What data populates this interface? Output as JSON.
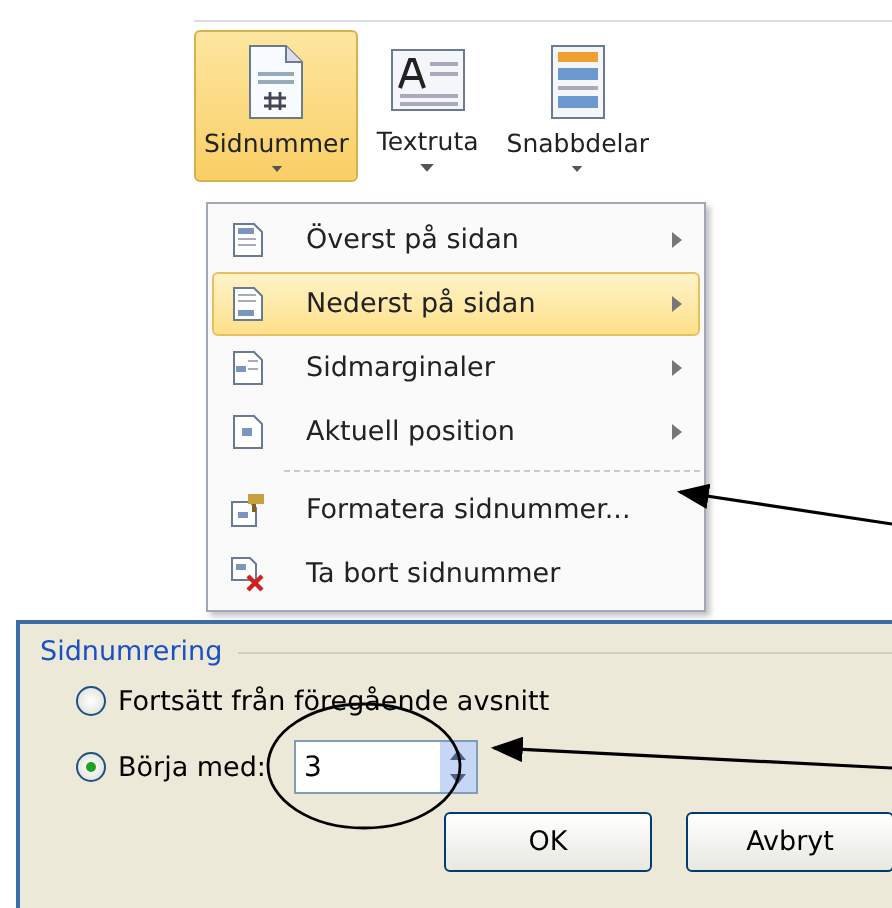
{
  "ribbon": {
    "buttons": [
      {
        "label": "Sidnummer",
        "selected": true
      },
      {
        "label": "Textruta",
        "selected": false
      },
      {
        "label": "Snabbdelar",
        "selected": false
      }
    ]
  },
  "menu": {
    "groups": [
      [
        {
          "label": "Överst på sidan",
          "submenu": true,
          "selected": false
        },
        {
          "label": "Nederst på sidan",
          "submenu": true,
          "selected": true
        },
        {
          "label": "Sidmarginaler",
          "submenu": true,
          "selected": false
        },
        {
          "label": "Aktuell position",
          "submenu": true,
          "selected": false
        }
      ],
      [
        {
          "label": "Formatera sidnummer...",
          "submenu": false,
          "selected": false
        },
        {
          "label": "Ta bort sidnummer",
          "submenu": false,
          "selected": false
        }
      ]
    ]
  },
  "dialog": {
    "group_title": "Sidnumrering",
    "options": [
      {
        "label": "Fortsätt från föregående avsnitt",
        "selected": false
      },
      {
        "label": "Börja med:",
        "selected": true,
        "value": "3"
      }
    ],
    "buttons": [
      "OK",
      "Avbryt"
    ]
  }
}
